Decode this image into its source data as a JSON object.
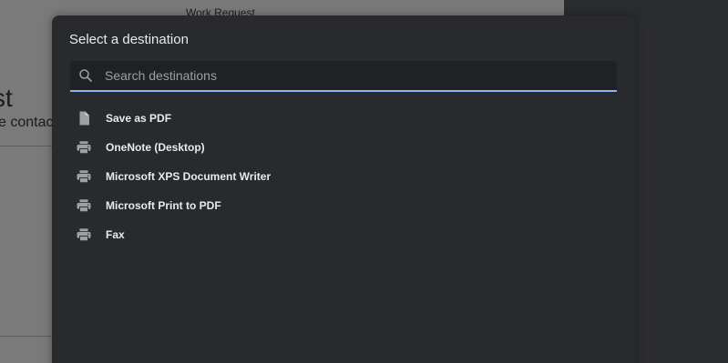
{
  "background": {
    "work_request_text": "Work Request",
    "heading_fragment": "st",
    "subtext_fragment": "e contac"
  },
  "dialog": {
    "title": "Select a destination",
    "search": {
      "placeholder": "Search destinations",
      "value": "",
      "icon": "search-icon"
    },
    "destinations": [
      {
        "label": "Save as PDF",
        "icon": "file-icon"
      },
      {
        "label": "OneNote (Desktop)",
        "icon": "printer-icon"
      },
      {
        "label": "Microsoft XPS Document Writer",
        "icon": "printer-icon"
      },
      {
        "label": "Microsoft Print to PDF",
        "icon": "printer-icon"
      },
      {
        "label": "Fax",
        "icon": "printer-icon"
      }
    ]
  },
  "colors": {
    "dialog_bg": "#292a2d",
    "search_bg": "#202124",
    "accent": "#8ab4f8",
    "text": "#e8eaed",
    "icon": "#9aa0a6"
  }
}
